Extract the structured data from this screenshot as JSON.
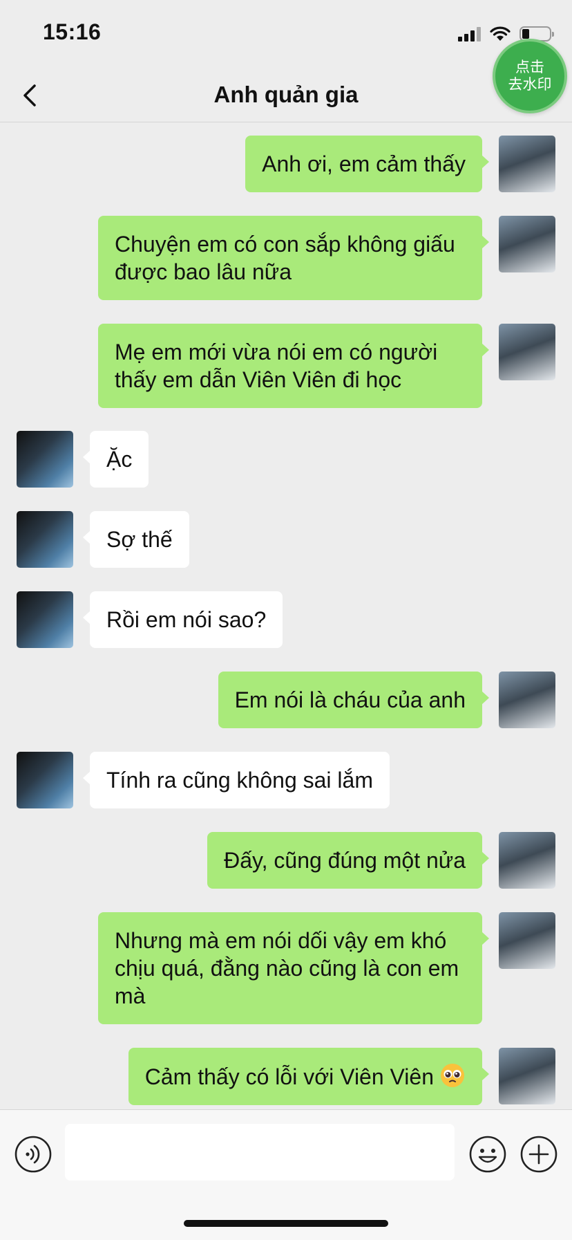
{
  "status_bar": {
    "time": "15:16",
    "battery_level": 0.2
  },
  "watermark_badge": {
    "line1": "点击",
    "line2": "去水印"
  },
  "nav": {
    "title": "Anh quản gia",
    "back_icon": "chevron-left-icon"
  },
  "messages": [
    {
      "side": "out",
      "text": "Anh ơi, em cảm thấy"
    },
    {
      "side": "out",
      "text": "Chuyện em có con sắp không giấu được bao lâu nữa"
    },
    {
      "side": "out",
      "text": "Mẹ em mới vừa nói em có người thấy em dẫn Viên Viên đi học"
    },
    {
      "side": "in",
      "text": "Ặc"
    },
    {
      "side": "in",
      "text": "Sợ thế"
    },
    {
      "side": "in",
      "text": "Rồi em nói sao?"
    },
    {
      "side": "out",
      "text": "Em nói là cháu của anh"
    },
    {
      "side": "in",
      "text": "Tính ra cũng không sai lắm"
    },
    {
      "side": "out",
      "text": "Đấy, cũng đúng một nửa"
    },
    {
      "side": "out",
      "text": "Nhưng mà em nói dối vậy em khó chịu quá, đằng nào cũng là con em mà"
    },
    {
      "side": "out",
      "text": "Cảm thấy có lỗi với Viên Viên",
      "emoji": "pleading-face-emoji"
    }
  ],
  "input_bar": {
    "voice_icon": "voice-icon",
    "text_value": "",
    "emoji_icon": "smiley-icon",
    "plus_icon": "plus-icon"
  },
  "colors": {
    "outgoing_bubble": "#A9EA7A",
    "incoming_bubble": "#FFFFFF",
    "background": "#EDEDED",
    "badge": "#3DAE4E"
  }
}
